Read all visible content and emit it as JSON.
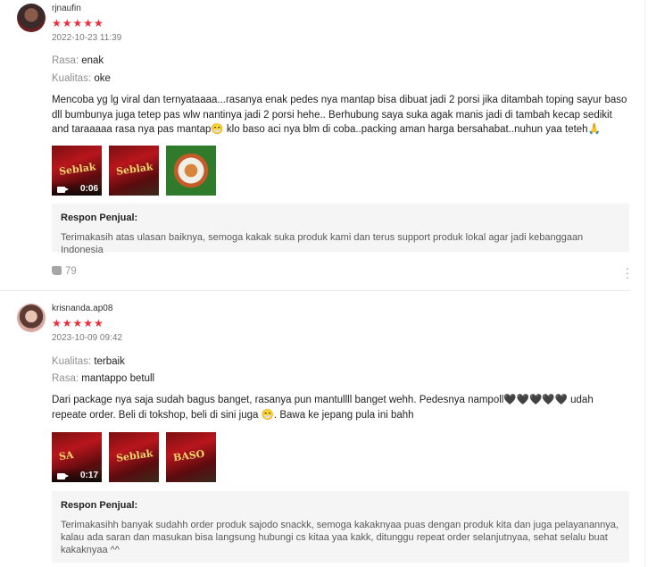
{
  "reviews": [
    {
      "username": "rjnaufin",
      "stars": "★★★★★",
      "rating": 5,
      "date": "2022-10-23 11:39",
      "attributes": [
        {
          "key": "Rasa:",
          "value": "enak"
        },
        {
          "key": "Kualitas:",
          "value": "oke"
        }
      ],
      "text": "Mencoba yg lg viral dan ternyataaaa...rasanya enak pedes nya mantap bisa dibuat jadi 2 porsi jika ditambah toping sayur baso dll bumbunya juga tetep pas wlw nantinya jadi 2 porsi hehe.. Berhubung saya suka agak manis jadi di tambah kecap sedikit and taraaaaa rasa nya pas mantap😁 klo baso aci nya blm di coba..packing aman harga bersahabat..nuhun yaa teteh🙏",
      "media": [
        {
          "type": "video",
          "duration": "0:06",
          "icon": "video-icon",
          "brand": "Seblak"
        },
        {
          "type": "image",
          "brand": "Seblak"
        },
        {
          "type": "image"
        }
      ],
      "seller_response": {
        "title": "Respon Penjual:",
        "text": "Terimakasih atas ulasan baiknya, semoga kakak suka produk kami dan terus support produk lokal agar jadi kebanggaan Indonesia"
      },
      "likes": "79"
    },
    {
      "username": "krisnanda.ap08",
      "stars": "★★★★★",
      "rating": 5,
      "date": "2023-10-09 09:42",
      "attributes": [
        {
          "key": "Kualitas:",
          "value": "terbaik"
        },
        {
          "key": "Rasa:",
          "value": "mantappo betull"
        }
      ],
      "text": "Dari package nya saja sudah bagus banget, rasanya pun mantullll banget wehh. Pedesnya nampoll🖤🖤🖤🖤🖤 udah repeate order. Beli di tokshop, beli di sini juga 😁. Bawa ke jepang pula ini bahh",
      "media": [
        {
          "type": "video",
          "duration": "0:17",
          "icon": "video-icon",
          "brand": "SA"
        },
        {
          "type": "image",
          "brand": "Seblak"
        },
        {
          "type": "image",
          "brand": "BASO"
        }
      ],
      "seller_response": {
        "title": "Respon Penjual:",
        "text": "Terimakasihh banyak sudahh order produk sajodo snackk, semoga kakaknyaa puas dengan produk kita dan juga pelayanannya, kalau ada saran dan masukan bisa langsung hubungi cs kitaa yaa kakk, ditunggu repeat order selanjutnyaa, sehat selalu buat kakaknyaa ^^"
      }
    }
  ],
  "colors": {
    "star": "#ee2b37",
    "response_bg": "#f5f5f5",
    "muted_text": "#8a8a8a"
  },
  "icons": {
    "like": "thumbs-up-icon",
    "more": "more-vertical-icon"
  }
}
